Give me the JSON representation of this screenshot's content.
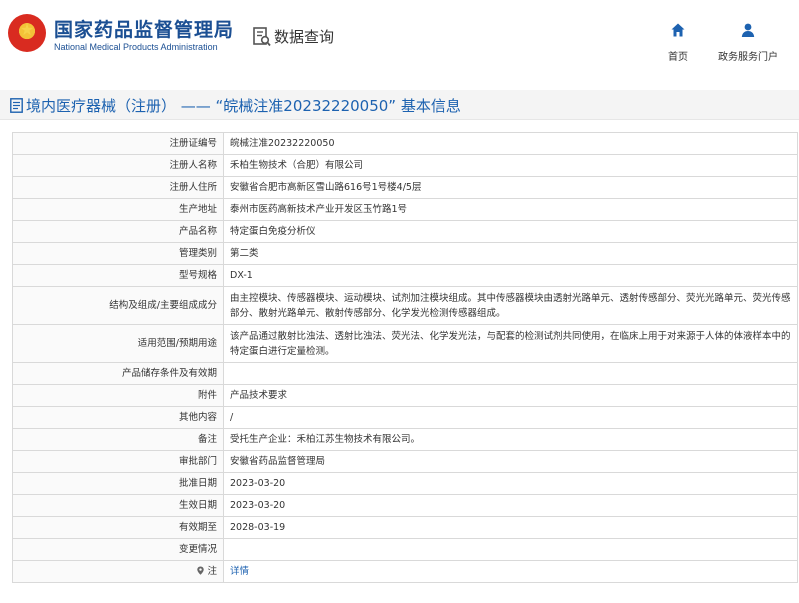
{
  "header": {
    "site_title": "国家药品监督管理局",
    "site_subtitle": "National Medical Products Administration",
    "query_title": "数据查询",
    "nav": [
      {
        "label": "首页",
        "icon": "home-icon"
      },
      {
        "label": "政务服务门户",
        "icon": "user-icon"
      }
    ]
  },
  "page": {
    "title": "境内医疗器械（注册） —— “皖械注准20232220050” 基本信息"
  },
  "colors": {
    "brand_blue": "#1b4f93",
    "title_blue": "#1d62b0",
    "emblem_red": "#d92b20",
    "emblem_gold": "#f3c238"
  },
  "table": {
    "rows": [
      {
        "label": "注册证编号",
        "value": "皖械注准20232220050"
      },
      {
        "label": "注册人名称",
        "value": "禾柏生物技术（合肥）有限公司"
      },
      {
        "label": "注册人住所",
        "value": "安徽省合肥市高新区雪山路616号1号楼4/5层"
      },
      {
        "label": "生产地址",
        "value": "泰州市医药高新技术产业开发区玉竹路1号"
      },
      {
        "label": "产品名称",
        "value": "特定蛋白免疫分析仪"
      },
      {
        "label": "管理类别",
        "value": "第二类"
      },
      {
        "label": "型号规格",
        "value": "DX-1"
      },
      {
        "label": "结构及组成/主要组成成分",
        "value": "由主控模块、传感器模块、运动模块、试剂加注模块组成。其中传感器模块由透射光路单元、透射传感部分、荧光光路单元、荧光传感部分、散射光路单元、散射传感部分、化学发光检测传感器组成。"
      },
      {
        "label": "适用范围/预期用途",
        "value": "该产品通过散射比浊法、透射比浊法、荧光法、化学发光法，与配套的检测试剂共同使用，在临床上用于对来源于人体的体液样本中的特定蛋白进行定量检测。"
      },
      {
        "label": "产品储存条件及有效期",
        "value": ""
      },
      {
        "label": "附件",
        "value": "产品技术要求"
      },
      {
        "label": "其他内容",
        "value": "/"
      },
      {
        "label": "备注",
        "value": "受托生产企业：禾柏江苏生物技术有限公司。"
      },
      {
        "label": "审批部门",
        "value": "安徽省药品监督管理局"
      },
      {
        "label": "批准日期",
        "value": "2023-03-20"
      },
      {
        "label": "生效日期",
        "value": "2023-03-20"
      },
      {
        "label": "有效期至",
        "value": "2028-03-19"
      },
      {
        "label": "变更情况",
        "value": ""
      },
      {
        "label": "注",
        "value": "详情",
        "label_icon": "location-pin-icon"
      }
    ]
  }
}
